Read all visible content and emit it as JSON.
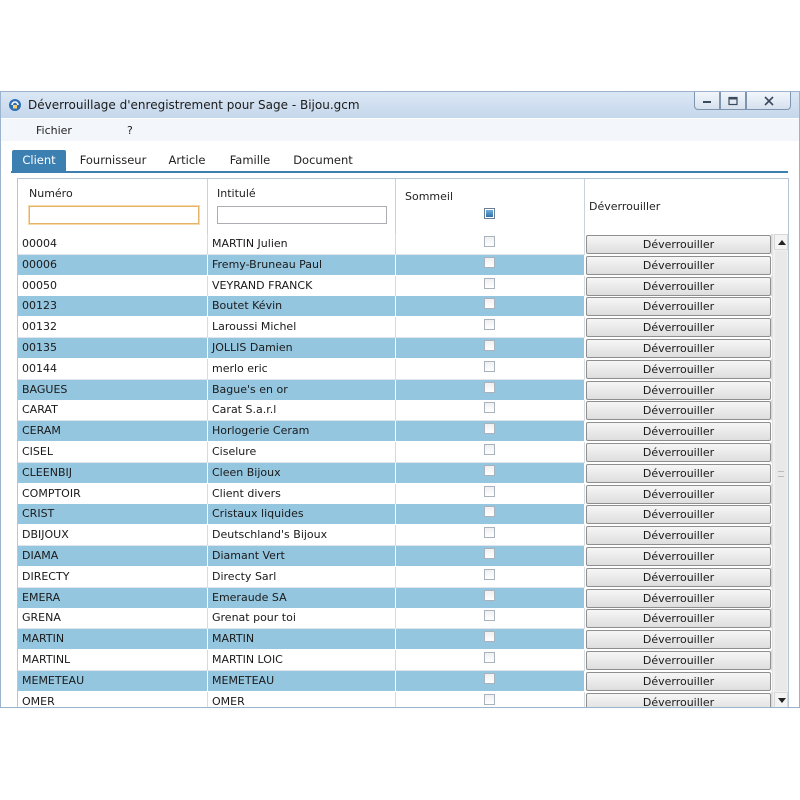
{
  "window": {
    "title": "Déverrouillage d'enregistrement pour Sage - Bijou.gcm"
  },
  "menu": {
    "items": [
      "Fichier",
      "?"
    ]
  },
  "tabs": [
    "Client",
    "Fournisseur",
    "Article",
    "Famille",
    "Document"
  ],
  "active_tab": "Client",
  "table": {
    "columns": [
      "Numéro",
      "Intitulé",
      "Sommeil",
      "Déverrouiller"
    ],
    "filters": {
      "numero": "",
      "intitule": ""
    },
    "header_sommeil_checked": true,
    "button_label": "Déverrouiller",
    "rows": [
      {
        "numero": "00004",
        "intitule": "MARTIN Julien"
      },
      {
        "numero": "00006",
        "intitule": "Fremy-Bruneau Paul"
      },
      {
        "numero": "00050",
        "intitule": "VEYRAND FRANCK"
      },
      {
        "numero": "00123",
        "intitule": "Boutet Kévin"
      },
      {
        "numero": "00132",
        "intitule": "Laroussi Michel"
      },
      {
        "numero": "00135",
        "intitule": "JOLLIS Damien"
      },
      {
        "numero": "00144",
        "intitule": "merlo eric"
      },
      {
        "numero": "BAGUES",
        "intitule": "Bague's en or"
      },
      {
        "numero": "CARAT",
        "intitule": "Carat S.a.r.l"
      },
      {
        "numero": "CERAM",
        "intitule": "Horlogerie Ceram"
      },
      {
        "numero": "CISEL",
        "intitule": "Ciselure"
      },
      {
        "numero": "CLEENBIJ",
        "intitule": "Cleen Bijoux"
      },
      {
        "numero": "COMPTOIR",
        "intitule": "Client divers"
      },
      {
        "numero": "CRIST",
        "intitule": "Cristaux liquides"
      },
      {
        "numero": "DBIJOUX",
        "intitule": "Deutschland's Bijoux"
      },
      {
        "numero": "DIAMA",
        "intitule": "Diamant Vert"
      },
      {
        "numero": "DIRECTY",
        "intitule": "Directy Sarl"
      },
      {
        "numero": "EMERA",
        "intitule": "Emeraude SA"
      },
      {
        "numero": "GRENA",
        "intitule": "Grenat pour toi"
      },
      {
        "numero": "MARTIN",
        "intitule": "MARTIN"
      },
      {
        "numero": "MARTINL",
        "intitule": "MARTIN LOIC"
      },
      {
        "numero": "MEMETEAU",
        "intitule": "MEMETEAU"
      },
      {
        "numero": "OMER",
        "intitule": "OMER"
      }
    ]
  },
  "colors": {
    "accent": "#3c7fb1",
    "row_alt": "#95c6e0"
  }
}
